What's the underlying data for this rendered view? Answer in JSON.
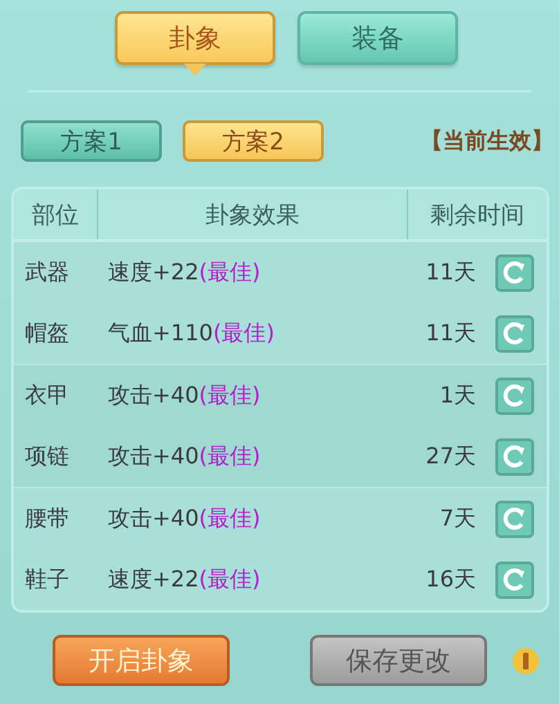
{
  "tabs": [
    {
      "label": "卦象",
      "selected": true
    },
    {
      "label": "装备",
      "selected": false
    }
  ],
  "plans": [
    {
      "label": "方案1",
      "selected": false
    },
    {
      "label": "方案2",
      "selected": true
    }
  ],
  "status": "【当前生效】",
  "table": {
    "columns": [
      "部位",
      "卦象效果",
      "剩余时间"
    ],
    "rows": [
      {
        "slot": "武器",
        "effect": "速度+22",
        "note": "(最佳)",
        "time": "11天"
      },
      {
        "slot": "帽盔",
        "effect": "气血+110",
        "note": "(最佳)",
        "time": "11天"
      },
      {
        "slot": "衣甲",
        "effect": "攻击+40",
        "note": "(最佳)",
        "time": "1天"
      },
      {
        "slot": "项链",
        "effect": "攻击+40",
        "note": "(最佳)",
        "time": "27天"
      },
      {
        "slot": "腰带",
        "effect": "攻击+40",
        "note": "(最佳)",
        "time": "7天"
      },
      {
        "slot": "鞋子",
        "effect": "速度+22",
        "note": "(最佳)",
        "time": "16天"
      }
    ]
  },
  "buttons": [
    {
      "label": "开启卦象",
      "disabled": false
    },
    {
      "label": "保存更改",
      "disabled": true
    }
  ]
}
